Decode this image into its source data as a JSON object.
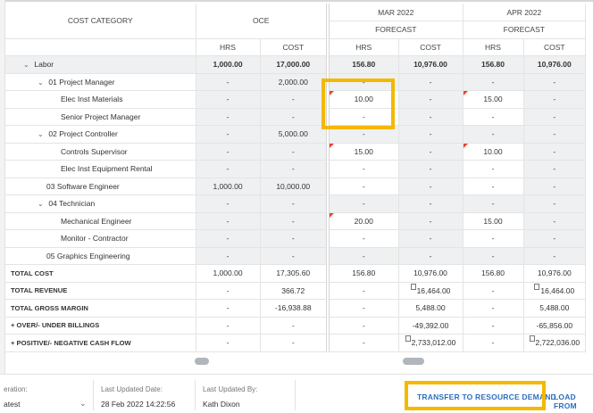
{
  "columns": {
    "cost_category": "COST CATEGORY",
    "oce": "OCE",
    "months": [
      {
        "label": "MAR 2022",
        "sub": "FORECAST"
      },
      {
        "label": "APR 2022",
        "sub": "FORECAST"
      }
    ],
    "hrs": "HRS",
    "cost": "COST"
  },
  "rows": [
    {
      "label": "Labor",
      "v": [
        "1,000.00",
        "17,000.00",
        "156.80",
        "10,976.00",
        "156.80",
        "10,976.00"
      ]
    },
    {
      "label": "01 Project Manager",
      "v": [
        "-",
        "2,000.00",
        "-",
        "-",
        "-",
        "-"
      ]
    },
    {
      "label": "Elec Inst Materials",
      "v": [
        "-",
        "-",
        "10.00",
        "-",
        "15.00",
        "-"
      ]
    },
    {
      "label": "Senior Project Manager",
      "v": [
        "-",
        "-",
        "-",
        "-",
        "-",
        "-"
      ]
    },
    {
      "label": "02 Project Controller",
      "v": [
        "-",
        "5,000.00",
        "-",
        "-",
        "-",
        "-"
      ]
    },
    {
      "label": "Controls Supervisor",
      "v": [
        "-",
        "-",
        "15.00",
        "-",
        "10.00",
        "-"
      ]
    },
    {
      "label": "Elec Inst Equipment Rental",
      "v": [
        "-",
        "-",
        "-",
        "-",
        "-",
        "-"
      ]
    },
    {
      "label": "03 Software Engineer",
      "v": [
        "1,000.00",
        "10,000.00",
        "-",
        "-",
        "-",
        "-"
      ]
    },
    {
      "label": "04 Technician",
      "v": [
        "-",
        "-",
        "-",
        "-",
        "-",
        "-"
      ]
    },
    {
      "label": "Mechanical Engineer",
      "v": [
        "-",
        "-",
        "20.00",
        "-",
        "15.00",
        "-"
      ]
    },
    {
      "label": "Monitor - Contractor",
      "v": [
        "-",
        "-",
        "-",
        "-",
        "-",
        "-"
      ]
    },
    {
      "label": "05 Graphics Engineering",
      "v": [
        "-",
        "-",
        "-",
        "-",
        "-",
        "-"
      ]
    }
  ],
  "totals": [
    {
      "label": "TOTAL COST",
      "v": [
        "1,000.00",
        "17,305.60",
        "156.80",
        "10,976.00",
        "156.80",
        "10,976.00"
      ]
    },
    {
      "label": "TOTAL REVENUE",
      "v": [
        "-",
        "366.72",
        "-",
        "16,464.00",
        "-",
        "16,464.00"
      ]
    },
    {
      "label": "TOTAL GROSS MARGIN",
      "v": [
        "-",
        "-16,938.88",
        "-",
        "5,488.00",
        "-",
        "5,488.00"
      ]
    },
    {
      "label": "+ OVER/- UNDER BILLINGS",
      "v": [
        "-",
        "-",
        "-",
        "-49,392.00",
        "-",
        "-65,856.00"
      ]
    },
    {
      "label": "+ POSITIVE/- NEGATIVE CASH FLOW",
      "v": [
        "-",
        "-",
        "-",
        "2,733,012.00",
        "-",
        "2,722,036.00"
      ]
    }
  ],
  "footer": {
    "version_label": "eration:",
    "version_value": "atest",
    "updated_date_label": "Last Updated Date:",
    "updated_date_value": "28 Feb 2022 14:22:56",
    "updated_by_label": "Last Updated By:",
    "updated_by_value": "Kath Dixon",
    "transfer_button": "TRANSFER TO RESOURCE DEMAND",
    "load_button": "LOAD FROM"
  },
  "colors": {
    "highlight": "#f5b800",
    "link": "#2c6fbf",
    "flag": "#e8432a"
  }
}
